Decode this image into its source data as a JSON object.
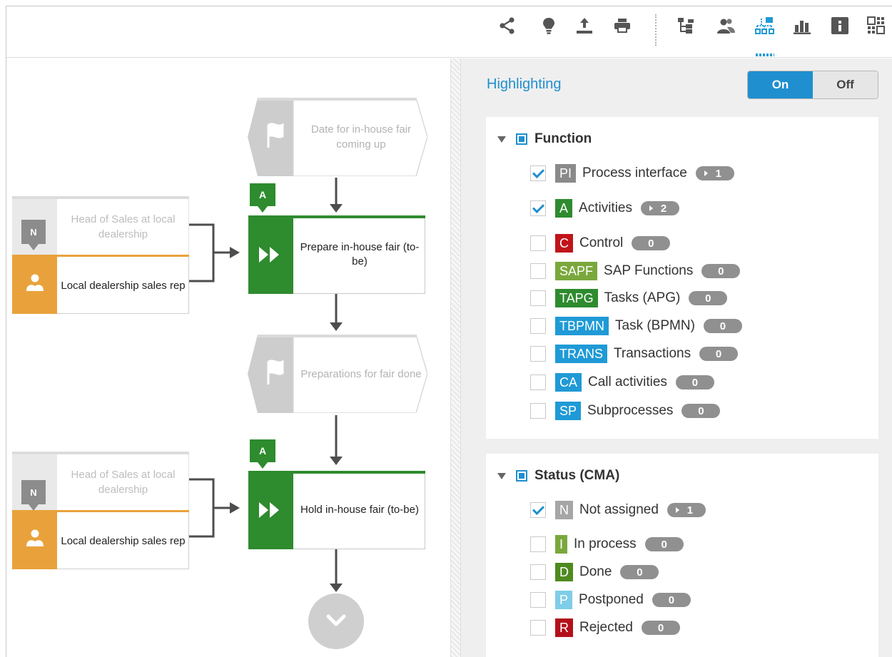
{
  "toolbar": {
    "icons": [
      "share-icon",
      "lightbulb-icon",
      "upload-icon",
      "print-icon",
      "hierarchy-icon",
      "users-icon",
      "highlight-diagram-icon",
      "bar-chart-icon",
      "info-icon",
      "grid-view-icon"
    ],
    "active_icon": "highlight-diagram-icon"
  },
  "diagram": {
    "event1": "Date for in-house fair coming up",
    "event2": "Preparations for fair done",
    "function1": {
      "tag": "A",
      "label": "Prepare in-house fair (to-be)"
    },
    "function2": {
      "tag": "A",
      "label": "Hold in-house fair (to-be)"
    },
    "role1": {
      "tag": "N",
      "top_label": "Head of Sales at local dealership",
      "bottom_label": "Local dealership sales rep"
    },
    "role2": {
      "tag": "N",
      "top_label": "Head of Sales at local dealership",
      "bottom_label": "Local dealership sales rep"
    }
  },
  "highlighting": {
    "title": "Highlighting",
    "on_label": "On",
    "off_label": "Off",
    "selected": "On"
  },
  "function_group": {
    "title": "Function",
    "items": [
      {
        "checked": true,
        "tag": "PI",
        "color": "#8a8a8a",
        "label": "Process interface",
        "count": "1",
        "expandable": true
      },
      {
        "checked": true,
        "tag": "A",
        "color": "#2e8b2e",
        "label": "Activities",
        "count": "2",
        "expandable": true
      },
      {
        "checked": false,
        "tag": "C",
        "color": "#c0141a",
        "label": "Control",
        "count": "0",
        "expandable": false
      },
      {
        "checked": false,
        "tag": "SAPF",
        "color": "#7aa83c",
        "label": "SAP Functions",
        "count": "0",
        "expandable": false
      },
      {
        "checked": false,
        "tag": "TAPG",
        "color": "#2e8b2e",
        "label": "Tasks (APG)",
        "count": "0",
        "expandable": false
      },
      {
        "checked": false,
        "tag": "TBPMN",
        "color": "#1f9ad6",
        "label": "Task (BPMN)",
        "count": "0",
        "expandable": false
      },
      {
        "checked": false,
        "tag": "TRANS",
        "color": "#1f9ad6",
        "label": "Transactions",
        "count": "0",
        "expandable": false
      },
      {
        "checked": false,
        "tag": "CA",
        "color": "#1f9ad6",
        "label": "Call activities",
        "count": "0",
        "expandable": false
      },
      {
        "checked": false,
        "tag": "SP",
        "color": "#1f9ad6",
        "label": "Subprocesses",
        "count": "0",
        "expandable": false
      }
    ]
  },
  "status_group": {
    "title": "Status (CMA)",
    "items": [
      {
        "checked": true,
        "tag": "N",
        "color": "#a6a6a6",
        "label": "Not assigned",
        "count": "1",
        "expandable": true
      },
      {
        "checked": false,
        "tag": "I",
        "color": "#7aa83c",
        "label": "In process",
        "count": "0",
        "expandable": false
      },
      {
        "checked": false,
        "tag": "D",
        "color": "#4e8a1e",
        "label": "Done",
        "count": "0",
        "expandable": false
      },
      {
        "checked": false,
        "tag": "P",
        "color": "#7fcde8",
        "label": "Postponed",
        "count": "0",
        "expandable": false
      },
      {
        "checked": false,
        "tag": "R",
        "color": "#b3111a",
        "label": "Rejected",
        "count": "0",
        "expandable": false
      }
    ]
  }
}
